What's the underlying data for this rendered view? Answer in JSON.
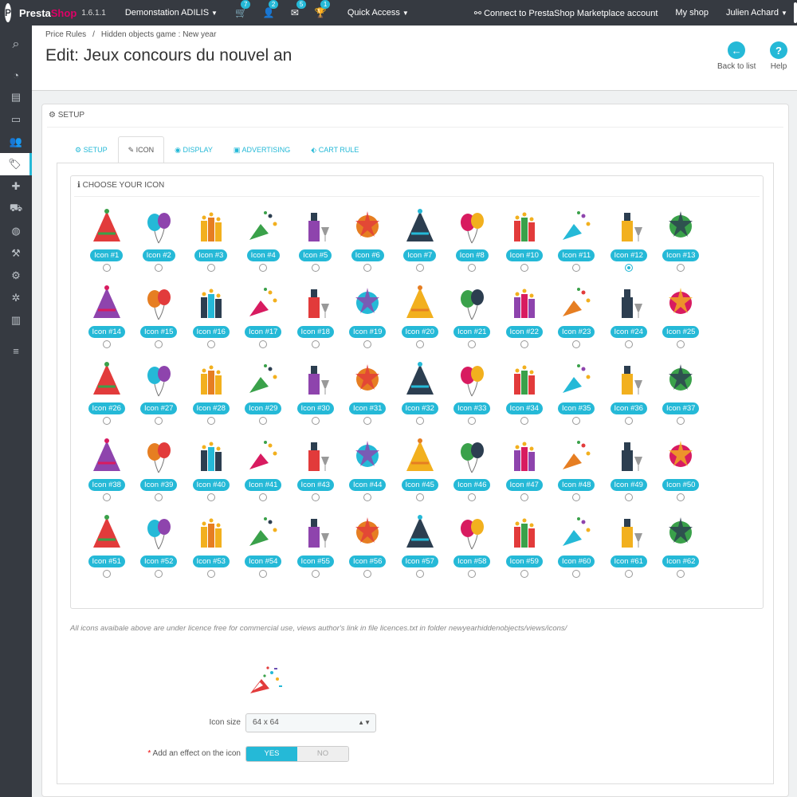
{
  "topbar": {
    "brand_a": "Presta",
    "brand_b": "Shop",
    "version": "1.6.1.1",
    "store": "Demonstation ADILIS",
    "cart_count": "7",
    "customers_count": "2",
    "messages_count": "5",
    "trophy_count": "1",
    "quick_access": "Quick Access",
    "marketplace": "Connect to PrestaShop Marketplace account",
    "my_shop": "My shop",
    "user": "Julien Achard"
  },
  "sidebar": {
    "icons": [
      "search-icon",
      "dashboard-icon",
      "orders-icon",
      "payment-icon",
      "customers-icon",
      "price-rules-icon",
      "modules-icon",
      "shipping-icon",
      "localization-icon",
      "preferences-icon",
      "advanced-icon",
      "admin-icon",
      "stats-icon",
      "menu-icon"
    ]
  },
  "header": {
    "crumb1": "Price Rules",
    "crumb2": "Hidden objects game : New year",
    "title": "Edit: Jeux concours du nouvel an",
    "back": "Back to list",
    "help": "Help"
  },
  "panel": {
    "heading": "Setup"
  },
  "tabs": [
    {
      "label": "Setup",
      "icon": "gears-icon"
    },
    {
      "label": "Icon",
      "icon": "brush-icon"
    },
    {
      "label": "Display",
      "icon": "eye-icon"
    },
    {
      "label": "Advertising",
      "icon": "image-icon"
    },
    {
      "label": "Cart rule",
      "icon": "tag-icon"
    }
  ],
  "icon_box": {
    "heading": "Choose your icon",
    "selected": "Icon #12"
  },
  "icons": [
    "Icon #1",
    "Icon #2",
    "Icon #3",
    "Icon #4",
    "Icon #5",
    "Icon #6",
    "Icon #7",
    "Icon #8",
    "Icon #10",
    "Icon #11",
    "Icon #12",
    "Icon #13",
    "Icon #14",
    "Icon #15",
    "Icon #16",
    "Icon #17",
    "Icon #18",
    "Icon #19",
    "Icon #20",
    "Icon #21",
    "Icon #22",
    "Icon #23",
    "Icon #24",
    "Icon #25",
    "Icon #26",
    "Icon #27",
    "Icon #28",
    "Icon #29",
    "Icon #30",
    "Icon #31",
    "Icon #32",
    "Icon #33",
    "Icon #34",
    "Icon #35",
    "Icon #36",
    "Icon #37",
    "Icon #38",
    "Icon #39",
    "Icon #40",
    "Icon #41",
    "Icon #43",
    "Icon #44",
    "Icon #45",
    "Icon #46",
    "Icon #47",
    "Icon #48",
    "Icon #49",
    "Icon #50",
    "Icon #51",
    "Icon #52",
    "Icon #53",
    "Icon #54",
    "Icon #55",
    "Icon #56",
    "Icon #57",
    "Icon #58",
    "Icon #59",
    "Icon #60",
    "Icon #61",
    "Icon #62"
  ],
  "note": "All icons avaibale above are under licence free for commercial use, views author's link in file licences.txt in folder newyearhiddenobjects/views/icons/",
  "form": {
    "size_label": "Icon size",
    "size_value": "64 x 64",
    "effect_label": "Add an effect on the icon",
    "required_mark": "*",
    "yes": "YES",
    "no": "NO"
  },
  "colors": {
    "accent": "#25b9d7",
    "topbar": "#363a41"
  }
}
